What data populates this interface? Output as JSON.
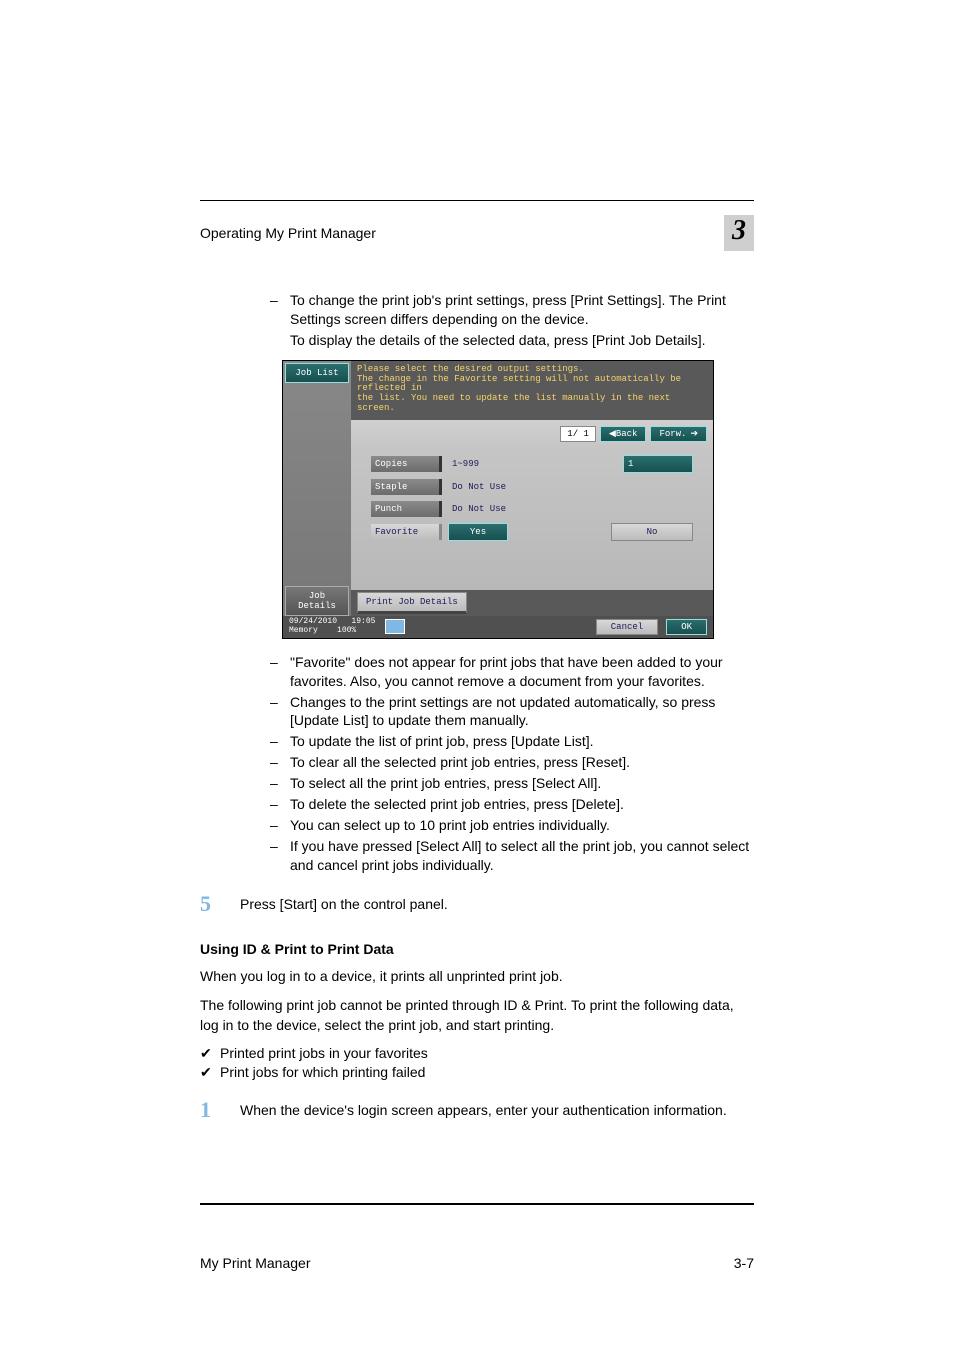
{
  "header": {
    "title": "Operating My Print Manager",
    "chapter": "3"
  },
  "intro_bullets": {
    "b1": "To change the print job's print settings, press [Print Settings]. The Print Settings screen differs depending on the device.",
    "b1_cont": "To display the details of the selected data, press [Print Job Details]."
  },
  "device": {
    "sidebar": {
      "job_list": "Job List",
      "job_details": "Job Details"
    },
    "msg": {
      "l1": "Please select the desired output settings.",
      "l2": "The change in the Favorite setting will not automatically be reflected in",
      "l3": "the list. You need to update the list manually in the next screen."
    },
    "pagebar": {
      "pages": "1/ 1",
      "back": "◀Back",
      "forw_label": "Forw.",
      "arrow": "➔"
    },
    "rows": {
      "copies_label": "Copies",
      "copies_hint": "1~999",
      "copies_val": "1",
      "staple_label": "Staple",
      "staple_hint": "Do Not Use",
      "punch_label": "Punch",
      "punch_hint": "Do Not Use",
      "favorite_label": "Favorite",
      "fav_yes": "Yes",
      "fav_no": "No"
    },
    "print_details": "Print Job Details",
    "footer": {
      "date": "09/24/2010",
      "time": "19:05",
      "mem_label": "Memory",
      "mem_val": "100%",
      "cancel": "Cancel",
      "ok": "OK"
    }
  },
  "bullets2": {
    "b1": "\"Favorite\" does not appear for print jobs that have been added to your favorites. Also, you cannot remove a document from your favorites.",
    "b2": "Changes to the print settings are not updated automatically, so press [Update List] to update them manually.",
    "b3": "To update the list of print job, press [Update List].",
    "b4": "To clear all the selected print job entries, press [Reset].",
    "b5": "To select all the print job entries, press [Select All].",
    "b6": "To delete the selected print job entries, press [Delete].",
    "b7": "You can select up to 10 print job entries individually.",
    "b8": "If you have pressed [Select All] to select all the print job, you cannot select and cancel print jobs individually."
  },
  "step5": {
    "num": "5",
    "text": "Press [Start] on the control panel."
  },
  "section": {
    "heading": "Using ID & Print to Print Data",
    "p1": "When you log in to a device, it prints all unprinted print job.",
    "p2": "The following print job cannot be printed through ID & Print. To print the following data, log in to the device, select the print job, and start printing.",
    "c1": "Printed print jobs in your favorites",
    "c2": "Print jobs for which printing failed"
  },
  "step1b": {
    "num": "1",
    "text": "When the device's login screen appears, enter your authentication information."
  },
  "footer": {
    "left": "My Print Manager",
    "right": "3-7"
  }
}
